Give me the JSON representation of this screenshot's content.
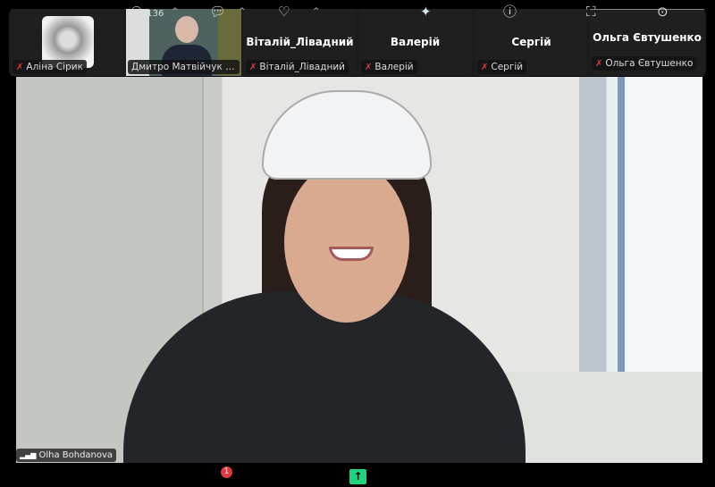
{
  "participants_strip": [
    {
      "name": "Аліна Сірик",
      "video": true
    },
    {
      "name": "Дмитро Матвійчук Жур...",
      "video": true
    },
    {
      "name": "Віталій_Лівадний",
      "label": "Віталій_Лівадний"
    },
    {
      "name": "Валерій",
      "label": "Валерій"
    },
    {
      "name": "Сергій",
      "label": "Сергій"
    },
    {
      "name": "Ольга Євтушенко",
      "label": "Ольга Євтушенко"
    }
  ],
  "active_speaker": {
    "name": "Olha Bohdanova"
  },
  "toolbar": {
    "participants_count": "136",
    "chat_badge": "1"
  },
  "colors": {
    "mute": "#e0393e",
    "share": "#1fd37f",
    "badge": "#e0393e"
  }
}
